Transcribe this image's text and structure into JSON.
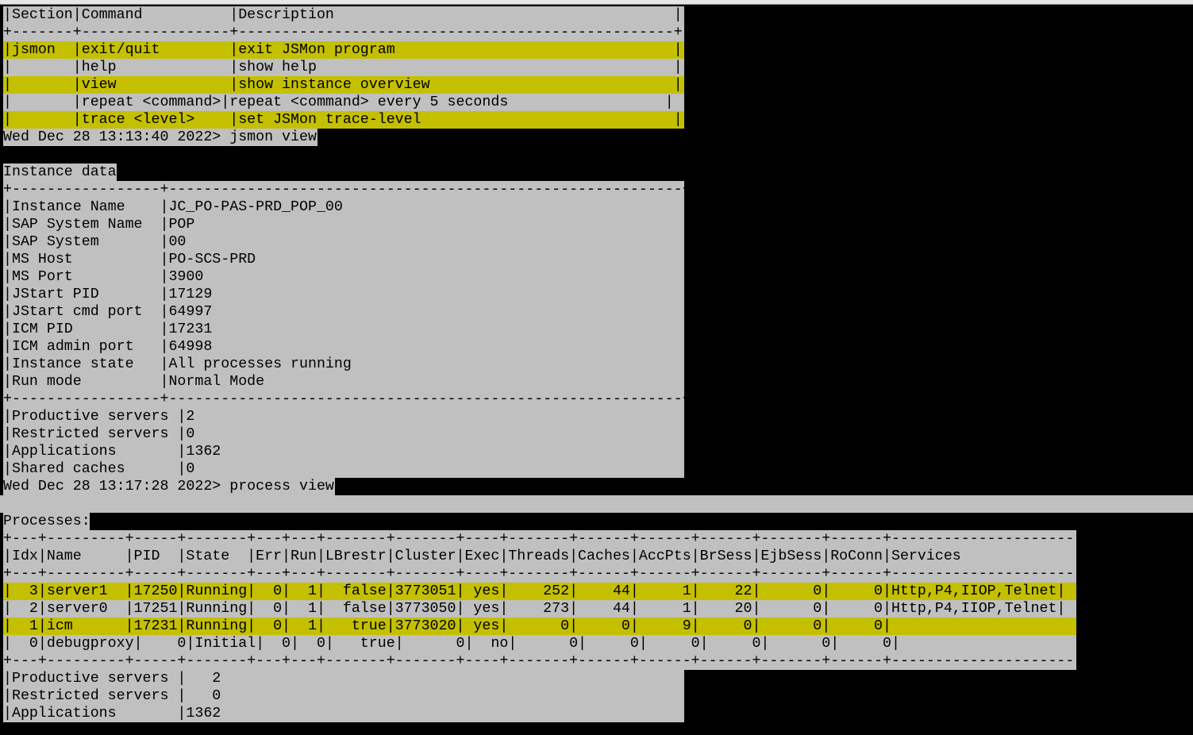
{
  "help_table": {
    "header": "|Section|Command          |Description                                       |",
    "separator": "+-------+-----------------+--------------------------------------------------+",
    "rows": [
      "|jsmon  |exit/quit        |exit JSMon program                                |",
      "|       |help             |show help                                         |",
      "|       |view             |show instance overview                            |",
      "|       |repeat <command>|repeat <command> every 5 seconds                  |",
      "|       |trace <level>    |set JSMon trace-level                             |"
    ]
  },
  "prompts": {
    "jsmon_view": "Wed Dec 28 13:13:40 2022> jsmon view",
    "process_view": "Wed Dec 28 13:17:28 2022> process view"
  },
  "instance": {
    "title": "Instance data",
    "separator": "+-----------------+-----------------------------------------------------------+",
    "rows": [
      "|Instance Name    |JC_PO-PAS-PRD_POP_00                                       |",
      "|SAP System Name  |POP                                                        |",
      "|SAP System       |00                                                         |",
      "|MS Host          |PO-SCS-PRD                                                 |",
      "|MS Port          |3900                                                       |",
      "|JStart PID       |17129                                                      |",
      "|JStart cmd port  |64997                                                      |",
      "|ICM PID          |17231                                                      |",
      "|ICM admin port   |64998                                                      |",
      "|Instance state   |All processes running                                      |",
      "|Run mode         |Normal Mode                                                |"
    ],
    "summary_rows": [
      "|Productive servers |2                                                         |",
      "|Restricted servers |0                                                         |",
      "|Applications       |1362                                                      |",
      "|Shared caches      |0                                                         |"
    ]
  },
  "processes": {
    "title": "Processes:",
    "separator": "+---+---------+-----+-------+---+---+-------+-------+----+-------+------+------+------+-------+------+----------------------+",
    "header": "|Idx|Name     |PID  |State  |Err|Run|LBrestr|Cluster|Exec|Threads|Caches|AccPts|BrSess|EjbSess|RoConn|Services              |",
    "rows": [
      "|  3|server1  |17250|Running|  0|  1|  false|3773051| yes|    252|    44|     1|    22|      0|     0|Http,P4,IIOP,Telnet|",
      "|  2|server0  |17251|Running|  0|  1|  false|3773050| yes|    273|    44|     1|    20|      0|     0|Http,P4,IIOP,Telnet|",
      "|  1|icm      |17231|Running|  0|  1|   true|3773020| yes|      0|     0|     9|     0|      0|     0|                      |",
      "|  0|debugproxy|    0|Initial|  0|  0|   true|      0|  no|      0|     0|     0|     0|      0|     0|"
    ],
    "summary_rows": [
      "|Productive servers |   2                                                      |",
      "|Restricted servers |   0                                                      |",
      "|Applications       |1362                                                      |"
    ]
  }
}
